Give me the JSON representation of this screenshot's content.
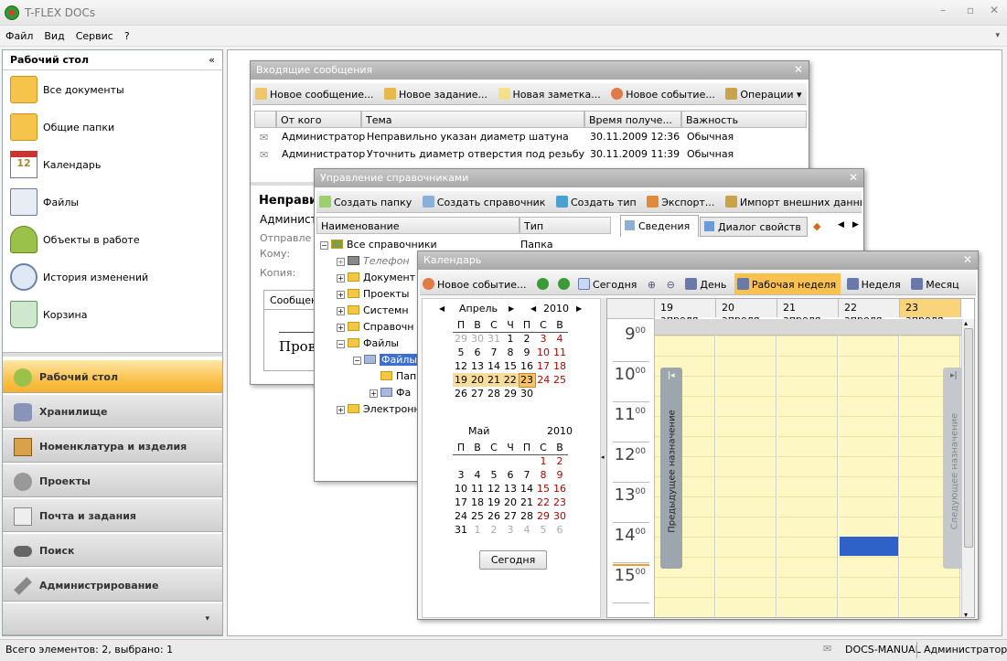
{
  "app": {
    "title": "T-FLEX DOCs"
  },
  "menu": [
    "Файл",
    "Вид",
    "Сервис",
    "?"
  ],
  "sidebar": {
    "title": "Рабочий стол",
    "collapse": "«",
    "items": [
      "Все документы",
      "Общие папки",
      "Календарь",
      "Файлы",
      "Объекты в работе",
      "История изменений",
      "Корзина"
    ],
    "groups": [
      "Рабочий стол",
      "Хранилище",
      "Номенклатура и изделия",
      "Проекты",
      "Почта и задания",
      "Поиск",
      "Администрирование"
    ]
  },
  "inbox": {
    "title": "Входящие сообщения",
    "toolbar": [
      "Новое сообщение...",
      "Новое задание...",
      "Новая заметка...",
      "Новое событие...",
      "Операции"
    ],
    "columns": [
      "От кого",
      "Тема",
      "Время получе...",
      "Важность"
    ],
    "rows": [
      [
        "Администратор",
        "Неправильно указан диаметр шатуна",
        "30.11.2009 12:36",
        "Обычная"
      ],
      [
        "Администратор",
        "Уточнить диаметр отверстия под резьбу",
        "30.11.2009 11:39",
        "Обычная"
      ]
    ],
    "preview": {
      "subject": "Неправи",
      "from": "Админист",
      "sent": "Отправле",
      "to": "Кому:",
      "copy": "Копия:",
      "tab": "Сообщен",
      "body": "Прово"
    }
  },
  "directories": {
    "title": "Управление справочниками",
    "toolbar": [
      "Создать папку",
      "Создать справочник",
      "Создать тип",
      "Экспорт...",
      "Импорт внешних данных..."
    ],
    "columns": [
      "Наименование",
      "Тип"
    ],
    "tree": [
      {
        "label": "Все справочники",
        "type": "Папка"
      },
      {
        "label": "Телефон",
        "type": ""
      },
      {
        "label": "Документ",
        "type": ""
      },
      {
        "label": "Проекты",
        "type": ""
      },
      {
        "label": "Системн",
        "type": ""
      },
      {
        "label": "Справочн",
        "type": ""
      },
      {
        "label": "Файлы",
        "type": ""
      },
      {
        "label": "Файлы",
        "type": ""
      },
      {
        "label": "Пап",
        "type": ""
      },
      {
        "label": "Фа",
        "type": ""
      },
      {
        "label": "Электронн",
        "type": ""
      }
    ],
    "tabs": [
      "Сведения",
      "Диалог свойств"
    ]
  },
  "calendar": {
    "title": "Календарь",
    "toolbar": [
      "Новое событие...",
      "Сегодня",
      "День",
      "Рабочая неделя",
      "Неделя",
      "Месяц"
    ],
    "april": {
      "month": "Апрель",
      "year": "2010",
      "weekdays": [
        "П",
        "В",
        "С",
        "Ч",
        "П",
        "С",
        "В"
      ],
      "weeks": [
        [
          "29",
          "30",
          "31",
          "1",
          "2",
          "3",
          "4"
        ],
        [
          "5",
          "6",
          "7",
          "8",
          "9",
          "10",
          "11"
        ],
        [
          "12",
          "13",
          "14",
          "15",
          "16",
          "17",
          "18"
        ],
        [
          "19",
          "20",
          "21",
          "22",
          "23",
          "24",
          "25"
        ],
        [
          "26",
          "27",
          "28",
          "29",
          "30",
          "",
          ""
        ]
      ]
    },
    "may": {
      "month": "Май",
      "year": "2010",
      "weekdays": [
        "П",
        "В",
        "С",
        "Ч",
        "П",
        "С",
        "В"
      ],
      "weeks": [
        [
          "",
          "",
          "",
          "",
          "",
          "1",
          "2"
        ],
        [
          "3",
          "4",
          "5",
          "6",
          "7",
          "8",
          "9"
        ],
        [
          "10",
          "11",
          "12",
          "13",
          "14",
          "15",
          "16"
        ],
        [
          "17",
          "18",
          "19",
          "20",
          "21",
          "22",
          "23"
        ],
        [
          "24",
          "25",
          "26",
          "27",
          "28",
          "29",
          "30"
        ],
        [
          "31",
          "1",
          "2",
          "3",
          "4",
          "5",
          "6"
        ]
      ]
    },
    "today_button": "Сегодня",
    "days": [
      "19 апреля",
      "20 апреля",
      "21 апреля",
      "22 апреля",
      "23 апреля"
    ],
    "hours": [
      "9",
      "10",
      "11",
      "12",
      "13",
      "14",
      "15"
    ],
    "minutes": "00",
    "prev": "Предыдущее назначение",
    "next": "Следующее назначение"
  },
  "status": {
    "left": "Всего элементов: 2, выбрано: 1",
    "server": "DOCS-MANUAL",
    "user": "Администратор"
  }
}
